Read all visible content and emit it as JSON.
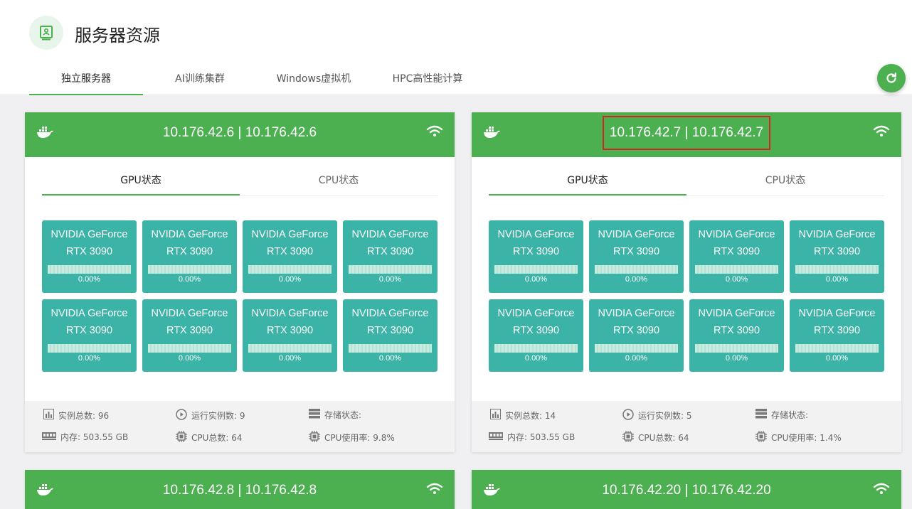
{
  "header": {
    "title": "服务器资源",
    "icon": "server-icon",
    "tabs": [
      {
        "label": "独立服务器",
        "active": true
      },
      {
        "label": "AI训练集群",
        "active": false
      },
      {
        "label": "Windows虚拟机",
        "active": false
      },
      {
        "label": "HPC高性能计算",
        "active": false
      }
    ],
    "refresh_icon": "refresh-icon"
  },
  "colors": {
    "accent": "#4caf50",
    "gpu_tile": "#3bb3a7",
    "highlight": "#d0281f"
  },
  "servers": [
    {
      "ip": "10.176.42.6 | 10.176.42.6",
      "tabs": [
        "GPU状态",
        "CPU状态"
      ],
      "gpus": [
        {
          "name": "NVIDIA GeForce RTX 3090",
          "usage": "0.00%"
        },
        {
          "name": "NVIDIA GeForce RTX 3090",
          "usage": "0.00%"
        },
        {
          "name": "NVIDIA GeForce RTX 3090",
          "usage": "0.00%"
        },
        {
          "name": "NVIDIA GeForce RTX 3090",
          "usage": "0.00%"
        },
        {
          "name": "NVIDIA GeForce RTX 3090",
          "usage": "0.00%"
        },
        {
          "name": "NVIDIA GeForce RTX 3090",
          "usage": "0.00%"
        },
        {
          "name": "NVIDIA GeForce RTX 3090",
          "usage": "0.00%"
        },
        {
          "name": "NVIDIA GeForce RTX 3090",
          "usage": "0.00%"
        }
      ],
      "stats": {
        "instances": "实例总数: 96",
        "running": "运行实例数: 9",
        "storage": "存储状态:",
        "memory": "内存: 503.55 GB",
        "cpu_count": "CPU总数: 64",
        "cpu_usage": "CPU使用率: 9.8%"
      }
    },
    {
      "ip": "10.176.42.7 | 10.176.42.7",
      "tabs": [
        "GPU状态",
        "CPU状态"
      ],
      "gpus": [
        {
          "name": "NVIDIA GeForce RTX 3090",
          "usage": "0.00%"
        },
        {
          "name": "NVIDIA GeForce RTX 3090",
          "usage": "0.00%"
        },
        {
          "name": "NVIDIA GeForce RTX 3090",
          "usage": "0.00%"
        },
        {
          "name": "NVIDIA GeForce RTX 3090",
          "usage": "0.00%"
        },
        {
          "name": "NVIDIA GeForce RTX 3090",
          "usage": "0.00%"
        },
        {
          "name": "NVIDIA GeForce RTX 3090",
          "usage": "0.00%"
        },
        {
          "name": "NVIDIA GeForce RTX 3090",
          "usage": "0.00%"
        },
        {
          "name": "NVIDIA GeForce RTX 3090",
          "usage": "0.00%"
        }
      ],
      "stats": {
        "instances": "实例总数: 14",
        "running": "运行实例数: 5",
        "storage": "存储状态:",
        "memory": "内存: 503.55 GB",
        "cpu_count": "CPU总数: 64",
        "cpu_usage": "CPU使用率: 1.4%"
      }
    },
    {
      "ip": "10.176.42.8 | 10.176.42.8"
    },
    {
      "ip": "10.176.42.20 | 10.176.42.20"
    }
  ]
}
